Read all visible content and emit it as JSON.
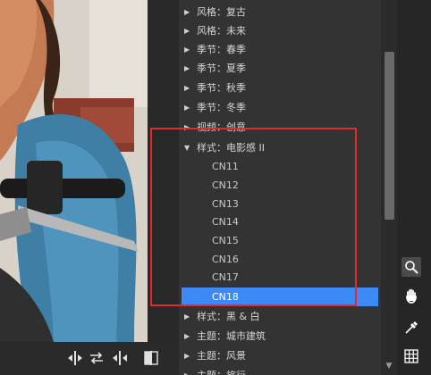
{
  "presets": {
    "items": [
      {
        "arrow": "▶",
        "label": "风格：复古"
      },
      {
        "arrow": "▶",
        "label": "风格：未来"
      },
      {
        "arrow": "▶",
        "label": "季节：春季"
      },
      {
        "arrow": "▶",
        "label": "季节：夏季"
      },
      {
        "arrow": "▶",
        "label": "季节：秋季"
      },
      {
        "arrow": "▶",
        "label": "季节：冬季"
      },
      {
        "arrow": "▶",
        "label": "视频：创意"
      },
      {
        "arrow": "▼",
        "label": "样式：电影感 II"
      },
      {
        "label": "CN11"
      },
      {
        "label": "CN12"
      },
      {
        "label": "CN13"
      },
      {
        "label": "CN14"
      },
      {
        "label": "CN15"
      },
      {
        "label": "CN16"
      },
      {
        "label": "CN17"
      },
      {
        "label": "CN18",
        "selected": true
      },
      {
        "arrow": "▶",
        "label": "样式：黑 & 白"
      },
      {
        "arrow": "▶",
        "label": "主题：城市建筑"
      },
      {
        "arrow": "▶",
        "label": "主题：风景"
      },
      {
        "arrow": "▶",
        "label": "主题：旅行"
      }
    ]
  },
  "icons": {
    "bottom_tools": [
      "split-left-right-icon",
      "swap-arrows-icon",
      "split-mirror-icon",
      "compare-panel-icon"
    ],
    "right_tools": [
      "zoom-icon",
      "hand-icon",
      "eyedropper-icon",
      "grid-icon"
    ]
  },
  "colors": {
    "selection": "#3d8af7",
    "annotation": "#e32b2b",
    "panel": "#333333"
  }
}
